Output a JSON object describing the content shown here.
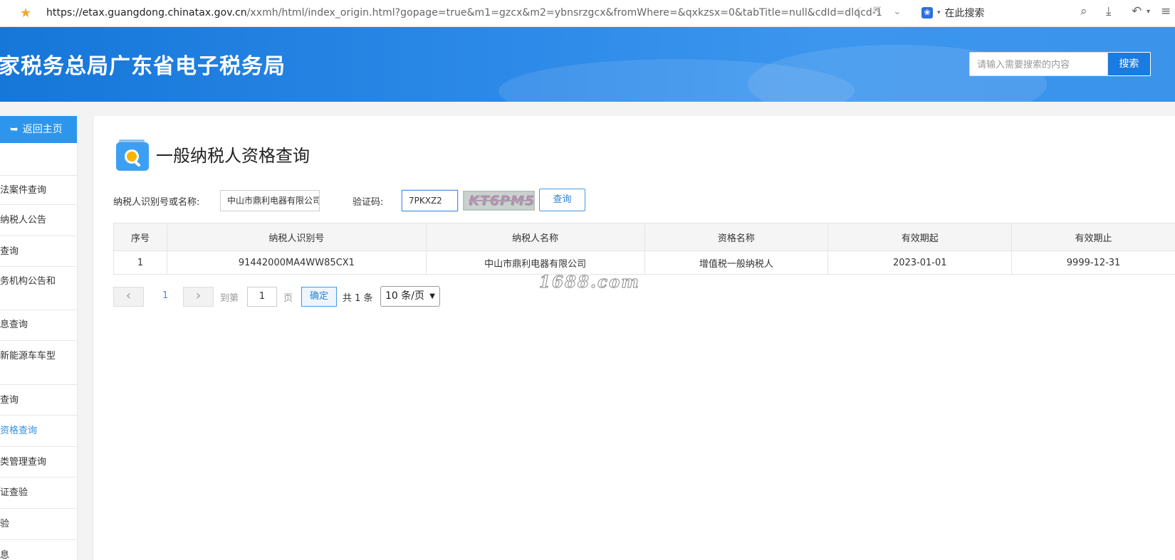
{
  "browser": {
    "url_main": "https://etax.guangdong.chinatax.gov.cn",
    "url_rest": "/xxmh/html/index_origin.html?gopage=true&m1=gzcx&m2=ybnsrzgcx&fromWhere=&qxkzsx=0&tabTitle=null&cdId=dlqcd-1",
    "search_label": "在此搜索"
  },
  "header": {
    "title": "家税务总局广东省电子税务局",
    "search_placeholder": "请输入需要搜索的内容",
    "search_button": "搜索"
  },
  "sidebar": {
    "back_label": "返回主页",
    "items": [
      {
        "label": "法案件查询"
      },
      {
        "label": "纳税人公告"
      },
      {
        "label": "查询"
      },
      {
        "label": "务机构公告和"
      },
      {
        "label": "息查询"
      },
      {
        "label": "新能源车车型"
      },
      {
        "label": "查询"
      },
      {
        "label": "资格查询"
      },
      {
        "label": "类管理查询"
      },
      {
        "label": "证查验"
      },
      {
        "label": "验"
      },
      {
        "label": "息"
      }
    ]
  },
  "main": {
    "title": "一般纳税人资格查询",
    "form": {
      "taxpayer_label": "纳税人识别号或名称:",
      "taxpayer_value": "中山市鼎利电器有限公司",
      "captcha_label": "验证码:",
      "captcha_value": "7PKXZ2",
      "captcha_image_text": "KT6PM5",
      "query_button": "查询"
    },
    "table": {
      "headers": [
        "序号",
        "纳税人识别号",
        "纳税人名称",
        "资格名称",
        "有效期起",
        "有效期止"
      ],
      "rows": [
        [
          "1",
          "91442000MA4WW85CX1",
          "中山市鼎利电器有限公司",
          "增值税一般纳税人",
          "2023-01-01",
          "9999-12-31"
        ]
      ]
    },
    "pager": {
      "prev": "‹",
      "current": "1",
      "next": "›",
      "goto_label": "到第",
      "goto_value": "1",
      "page_suffix": "页",
      "confirm": "确定",
      "total": "共 1 条",
      "page_size": "10 条/页"
    }
  },
  "watermark": "1688.com"
}
